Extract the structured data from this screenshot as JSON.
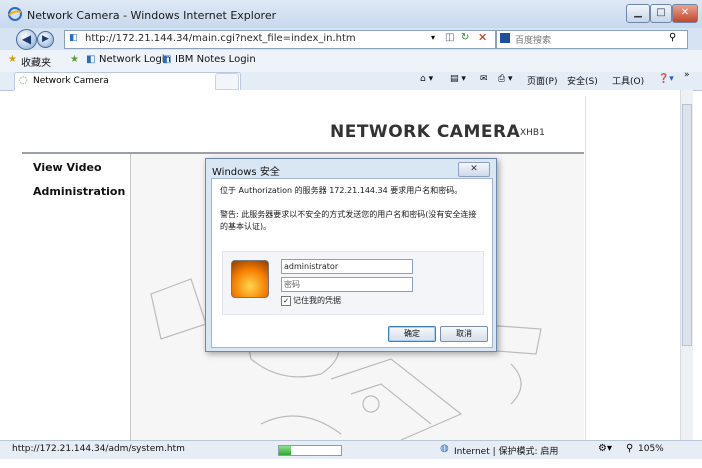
{
  "window": {
    "title": "Network Camera - Windows Internet Explorer",
    "min_icon": "minimize-icon",
    "max_icon": "maximize-icon",
    "close_icon": "close-icon"
  },
  "address_bar": {
    "url": "http://172.21.144.34/main.cgi?next_file=index_in.htm",
    "search_placeholder": "百度搜索"
  },
  "favorites_bar": {
    "favorites_label": "收藏夹",
    "links": [
      "Network Login",
      "IBM Notes Login"
    ]
  },
  "tabs": [
    {
      "label": "Network Camera"
    }
  ],
  "toolbar": {
    "page_label": "页面(P)",
    "safety_label": "安全(S)",
    "tools_label": "工具(O)"
  },
  "page": {
    "brand_title": "NETWORK CAMERA",
    "model": "XHB1",
    "menu": [
      "View Video",
      "Administration"
    ]
  },
  "dialog": {
    "title": "Windows 安全",
    "message": "位于 Authorization 的服务器 172.21.144.34 要求用户名和密码。",
    "warning": "警告: 此服务器要求以不安全的方式发送您的用户名和密码(没有安全连接的基本认证)。",
    "username_value": "administrator",
    "password_placeholder": "密码",
    "remember_label": "记住我的凭据",
    "remember_checked": "✓",
    "ok_label": "确定",
    "cancel_label": "取消"
  },
  "status_bar": {
    "url": "http://172.21.144.34/adm/system.htm",
    "progress": 0.2,
    "zone": "Internet | 保护模式: 启用",
    "zoom": "105%"
  },
  "colors": {
    "accent": "#3c7fb1",
    "progress": "#2ea82e"
  }
}
